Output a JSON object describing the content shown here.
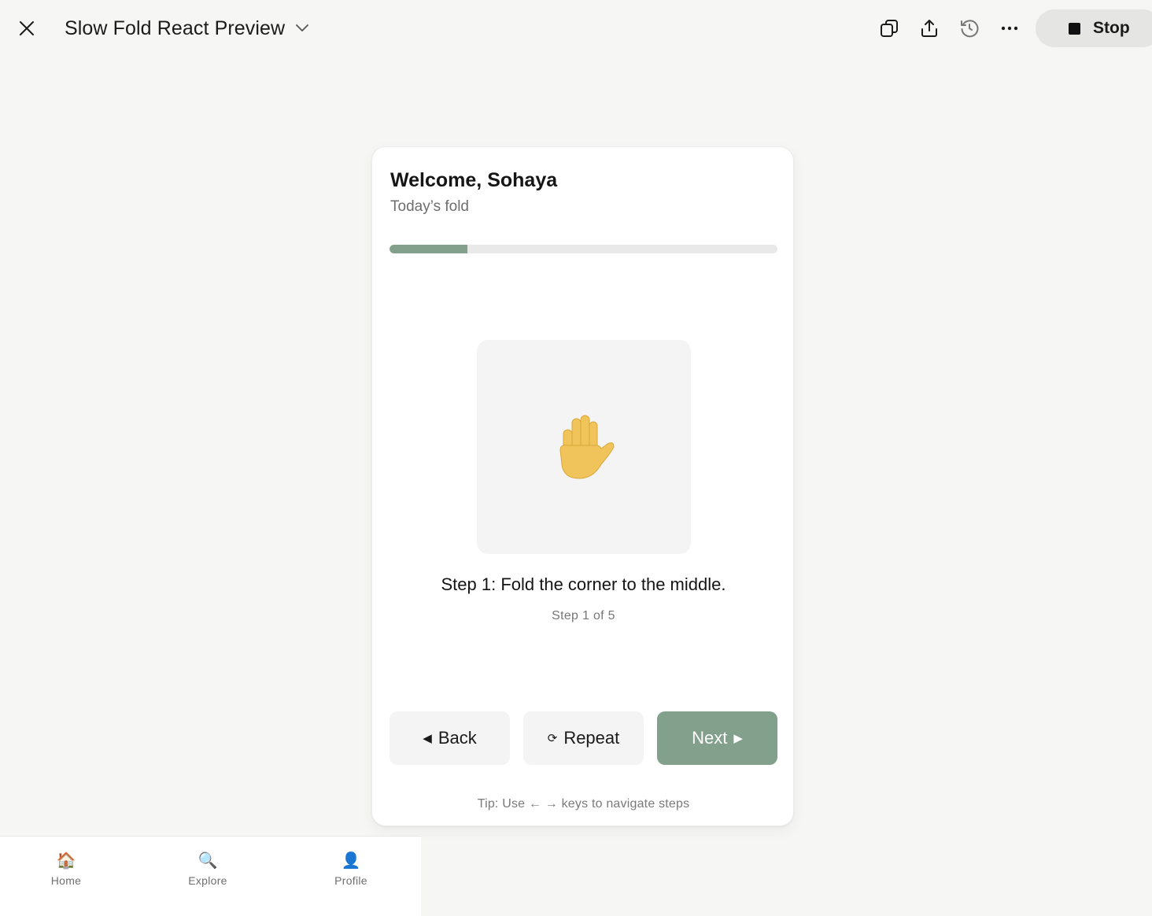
{
  "window": {
    "title": "Slow Fold React Preview",
    "stop_label": "Stop"
  },
  "toolbar": {
    "icons": [
      "copy-icon",
      "share-icon",
      "history-icon",
      "more-icon"
    ]
  },
  "card": {
    "welcome": "Welcome, Sohaya",
    "subtitle": "Today’s fold",
    "progress": 0.2,
    "illustration_emoji": "🖐",
    "step_text": "Step 1: Fold the corner to the middle.",
    "step_count": "Step 1 of 5",
    "buttons": {
      "back_glyph": "◀",
      "back": "Back",
      "repeat_glyph": "⟳",
      "repeat": "Repeat",
      "next": "Next",
      "next_glyph": "▶"
    },
    "tip": "Tip: Use ← → keys to navigate steps"
  },
  "nav": {
    "items": [
      {
        "label": "Home",
        "icon": "🏠"
      },
      {
        "label": "Explore",
        "icon": "🔍"
      },
      {
        "label": "Profile",
        "icon": "👤"
      }
    ]
  },
  "colors": {
    "accent": "#83a08d",
    "background": "#f6f6f5",
    "card": "#ffffff"
  }
}
